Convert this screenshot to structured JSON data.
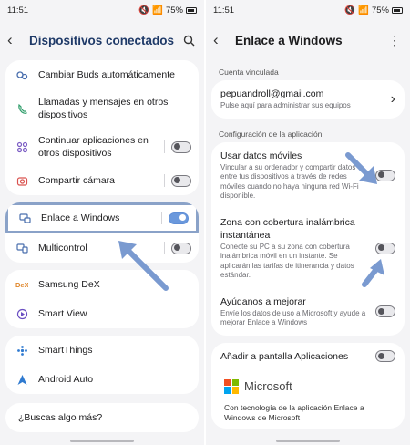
{
  "left": {
    "status": {
      "time": "11:51",
      "battery": "75%"
    },
    "header": {
      "title": "Dispositivos conectados"
    },
    "groups": [
      [
        {
          "label": "Cambiar Buds automáticamente",
          "toggle": null,
          "icon": "buds-icon"
        },
        {
          "label": "Llamadas y mensajes en otros dispositivos",
          "toggle": null,
          "icon": "phone-message-icon"
        },
        {
          "label": "Continuar aplicaciones en otros dispositivos",
          "toggle": false,
          "icon": "apps-continue-icon"
        },
        {
          "label": "Compartir cámara",
          "toggle": false,
          "icon": "camera-share-icon"
        }
      ],
      [
        {
          "label": "Enlace a Windows",
          "toggle": true,
          "icon": "link-windows-icon"
        },
        {
          "label": "Multicontrol",
          "toggle": false,
          "icon": "multicontrol-icon"
        }
      ],
      [
        {
          "label": "Samsung DeX",
          "toggle": null,
          "icon": "dex-icon"
        },
        {
          "label": "Smart View",
          "toggle": null,
          "icon": "smart-view-icon"
        }
      ],
      [
        {
          "label": "SmartThings",
          "toggle": null,
          "icon": "smartthings-icon"
        },
        {
          "label": "Android Auto",
          "toggle": null,
          "icon": "android-auto-icon"
        }
      ]
    ],
    "footer_peek": "¿Buscas algo más?"
  },
  "right": {
    "status": {
      "time": "11:51",
      "battery": "75%"
    },
    "header": {
      "title": "Enlace a Windows"
    },
    "linked_section": "Cuenta vinculada",
    "account": {
      "email": "pepuandroll@gmail.com",
      "sub": "Pulse aquí para administrar sus equipos"
    },
    "config_section": "Configuración de la aplicación",
    "settings": [
      {
        "title": "Usar datos móviles",
        "sub": "Vincular a su ordenador y compartir datos entre tus dispositivos a través de redes móviles cuando no haya ninguna red Wi-Fi disponible.",
        "toggle": false
      },
      {
        "title": "Zona con cobertura inalámbrica instantánea",
        "sub": "Conecte su PC a su zona con cobertura inalámbrica móvil en un instante. Se aplicarán las tarifas de itinerancia y datos estándar.",
        "toggle": false
      },
      {
        "title": "Ayúdanos a mejorar",
        "sub": "Envíe los datos de uso a Microsoft y ayude a mejorar Enlace a Windows",
        "toggle": false
      }
    ],
    "add_to_apps": {
      "label": "Añadir a pantalla Aplicaciones",
      "toggle": false
    },
    "brand": "Microsoft",
    "powered_by": "Con tecnología de la aplicación Enlace a Windows de Microsoft"
  },
  "colors": {
    "accent": "#6a98dc",
    "highlight": "#8aa2c8",
    "title_blue": "#1f3a68"
  }
}
